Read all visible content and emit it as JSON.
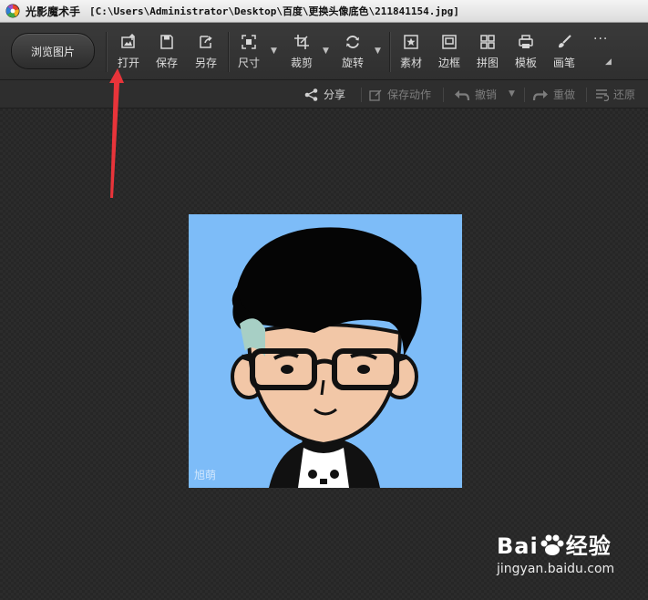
{
  "window": {
    "app_title": "光影魔术手",
    "path": "[C:\\Users\\Administrator\\Desktop\\百度\\更换头像底色\\211841154.jpg]"
  },
  "toolbar": {
    "browse_label": "浏览图片",
    "open_label": "打开",
    "save_label": "保存",
    "save_as_label": "另存",
    "size_label": "尺寸",
    "crop_label": "裁剪",
    "rotate_label": "旋转",
    "material_label": "素材",
    "border_label": "边框",
    "collage_label": "拼图",
    "template_label": "模板",
    "brush_label": "画笔",
    "more_label": "···"
  },
  "subbar": {
    "share_label": "分享",
    "save_action_label": "保存动作",
    "undo_label": "撤销",
    "redo_label": "重做",
    "restore_label": "还原"
  },
  "image": {
    "background_color": "#7dbcf8",
    "signature_text": "旭萌"
  },
  "watermark": {
    "brand_text": "Bai",
    "brand_text2": "经验",
    "url_text": "jingyan.baidu.com"
  },
  "colors": {
    "annotation_arrow": "#e8343a",
    "toolbar_bg": "#353535",
    "canvas_bg": "#282828"
  }
}
